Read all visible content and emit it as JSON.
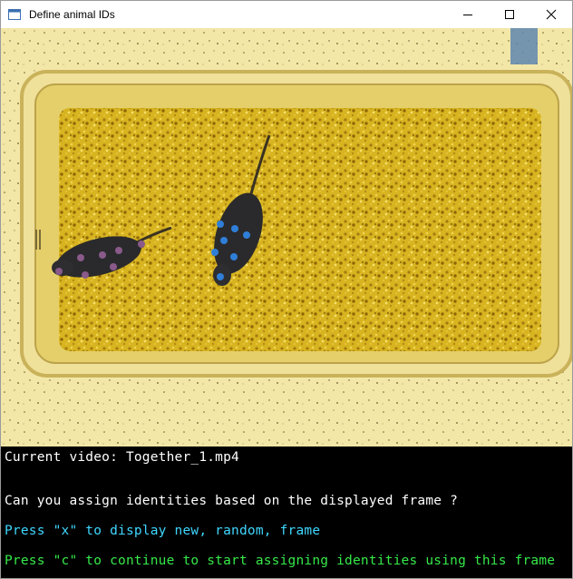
{
  "window": {
    "title": "Define animal IDs",
    "controls": {
      "minimize_icon": "minimize-icon",
      "maximize_icon": "maximize-icon",
      "close_icon": "close-icon"
    }
  },
  "frame": {
    "description_icon": "video-frame",
    "animals": [
      {
        "id": "animal-1",
        "keypoint_color": "#8a5a8a"
      },
      {
        "id": "animal-2",
        "keypoint_color": "#2f7fd8"
      }
    ]
  },
  "info": {
    "current_video": "Current video: Together_1.mp4",
    "question": "Can you assign identities based on the displayed frame ?",
    "instruction_x": "Press \"x\" to display new, random, frame",
    "instruction_c": "Press \"c\" to continue to start assigning identities using this frame"
  },
  "colors": {
    "instruction_x": "#3fd7ff",
    "instruction_c": "#36e94a",
    "text": "#ffffff",
    "panel_bg": "#000000"
  }
}
